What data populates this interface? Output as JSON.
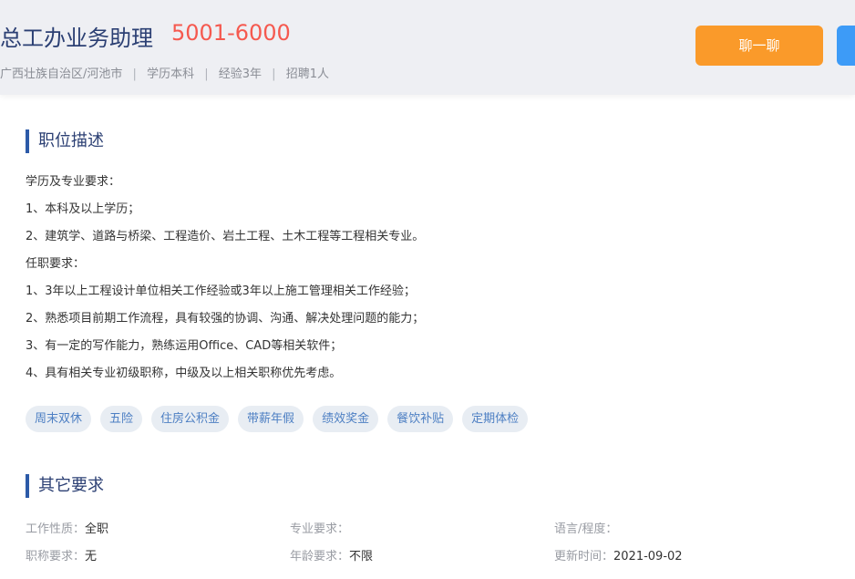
{
  "header": {
    "title": "总工办业务助理",
    "salary": "5001-6000",
    "meta": [
      "广西壮族自治区/河池市",
      "学历本科",
      "经验3年",
      "招聘1人"
    ],
    "meta_separator": "|",
    "chat_button": "聊一聊",
    "colors": {
      "accent_orange": "#fa9a2a",
      "accent_blue": "#3d9bf7",
      "salary_red": "#f5594f"
    }
  },
  "description": {
    "section_title": "职位描述",
    "lines": [
      "学历及专业要求：",
      "1、本科及以上学历；",
      "2、建筑学、道路与桥梁、工程造价、岩土工程、土木工程等工程相关专业。",
      "任职要求：",
      "1、3年以上工程设计单位相关工作经验或3年以上施工管理相关工作经验；",
      "2、熟悉项目前期工作流程，具有较强的协调、沟通、解决处理问题的能力；",
      "3、有一定的写作能力，熟练运用Office、CAD等相关软件；",
      "4、具有相关专业初级职称，中级及以上相关职称优先考虑。"
    ],
    "tags": [
      "周末双休",
      "五险",
      "住房公积金",
      "带薪年假",
      "绩效奖金",
      "餐饮补贴",
      "定期体检"
    ]
  },
  "other": {
    "section_title": "其它要求",
    "rows": [
      [
        {
          "label": "工作性质：",
          "value": "全职"
        },
        {
          "label": "专业要求：",
          "value": ""
        },
        {
          "label": "语言/程度：",
          "value": ""
        }
      ],
      [
        {
          "label": "职称要求：",
          "value": "无"
        },
        {
          "label": "年龄要求：",
          "value": "不限"
        },
        {
          "label": "更新时间：",
          "value": "2021-09-02"
        }
      ]
    ]
  }
}
